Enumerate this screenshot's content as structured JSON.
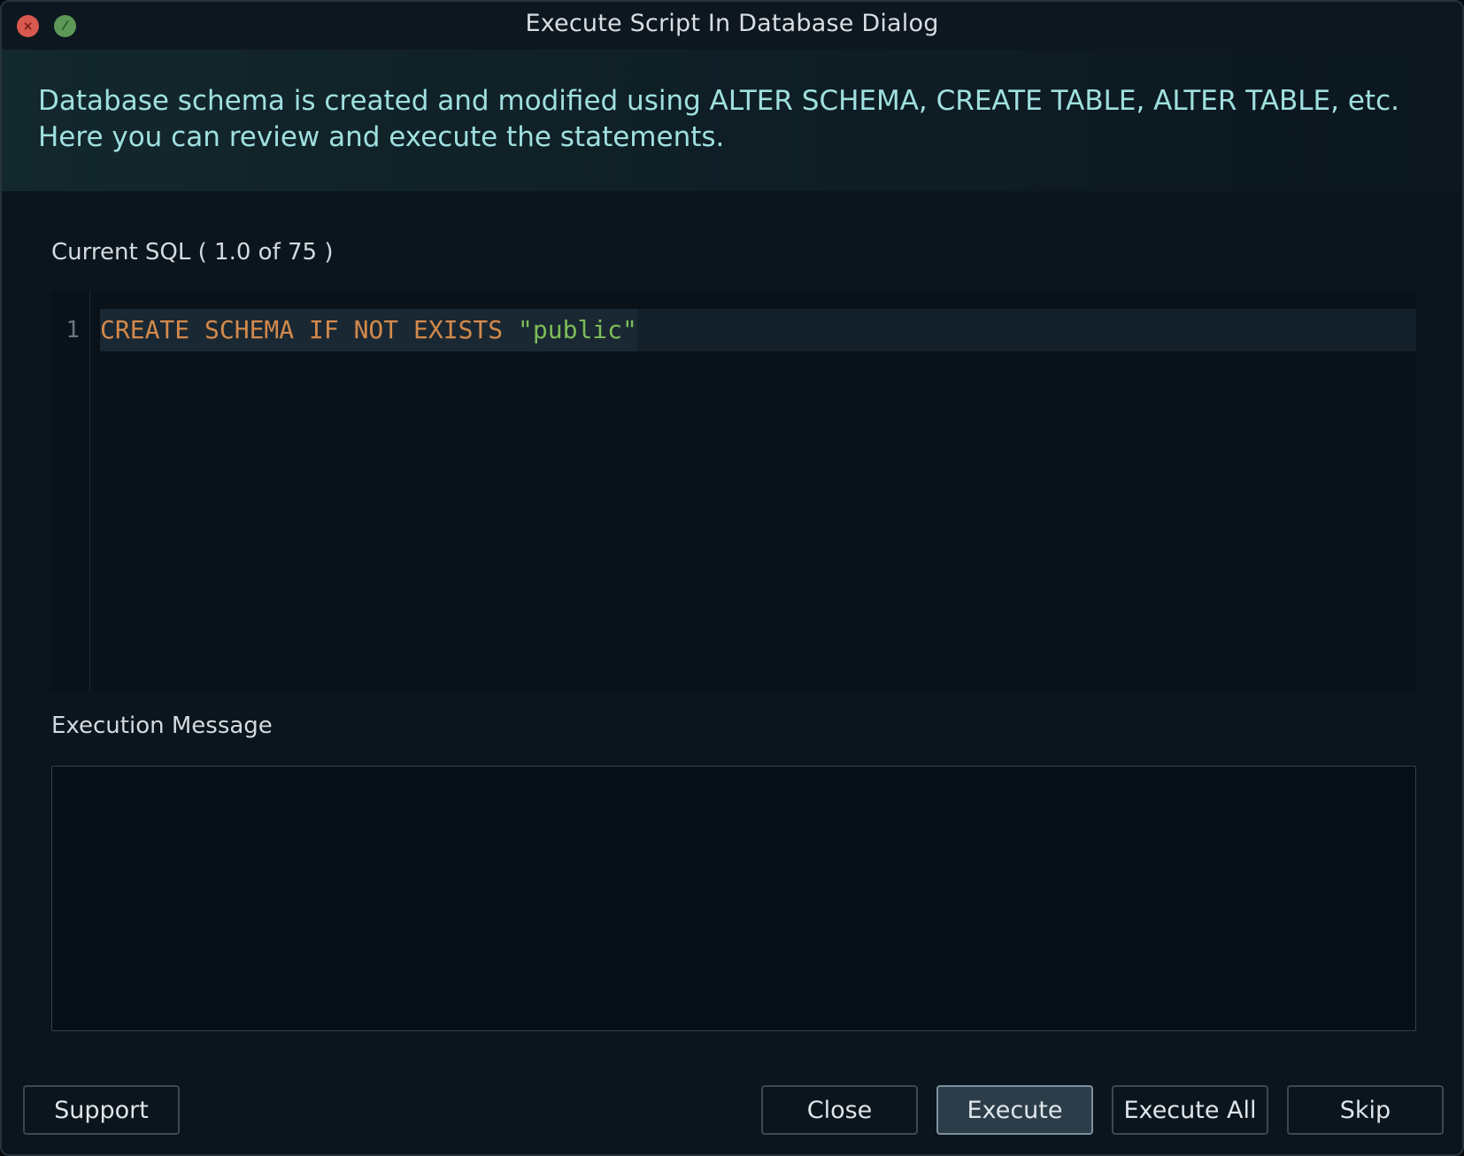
{
  "window": {
    "title": "Execute Script In Database Dialog"
  },
  "banner": {
    "text": "Database schema is created and modified using ALTER SCHEMA, CREATE TABLE, ALTER TABLE, etc.\n Here you can review and execute the statements."
  },
  "current_sql": {
    "label": "Current SQL ( 1.0 of 75 )",
    "line_number": "1",
    "keywords": "CREATE SCHEMA IF NOT EXISTS ",
    "string_literal": "\"public\""
  },
  "execution_message": {
    "label": "Execution Message",
    "value": ""
  },
  "buttons": {
    "support": "Support",
    "close": "Close",
    "execute": "Execute",
    "execute_all": "Execute All",
    "skip": "Skip"
  },
  "colors": {
    "banner_text": "#9fe0df",
    "keyword": "#d48a4c",
    "string": "#7ebd58",
    "close_dot": "#d8594f",
    "zoom_dot": "#5e9858"
  }
}
